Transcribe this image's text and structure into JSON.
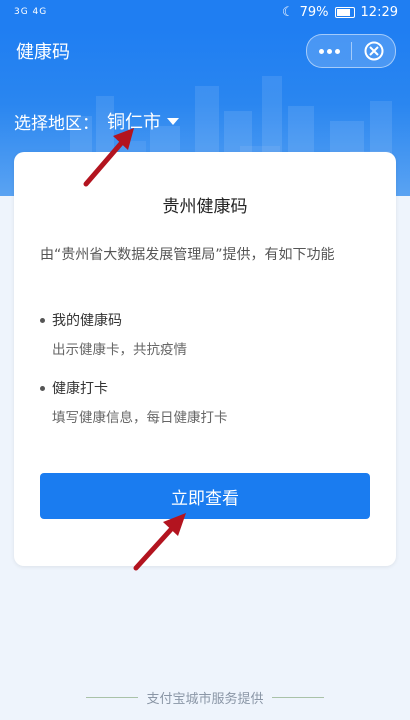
{
  "status_bar": {
    "signal": "3G  4G",
    "battery": "79%",
    "time": "12:29"
  },
  "header": {
    "title": "健康码",
    "region_label": "选择地区：",
    "region_value": "铜仁市"
  },
  "card": {
    "title": "贵州健康码",
    "intro": "由“贵州省大数据发展管理局”提供，有如下功能",
    "features": [
      {
        "title": "我的健康码",
        "desc": "出示健康卡，共抗疫情"
      },
      {
        "title": "健康打卡",
        "desc": "填写健康信息，每日健康打卡"
      }
    ],
    "cta_label": "立即查看"
  },
  "footer": {
    "text": "支付宝城市服务提供"
  },
  "colors": {
    "primary": "#1a7cf0",
    "annotation_arrow": "#b3141f"
  }
}
